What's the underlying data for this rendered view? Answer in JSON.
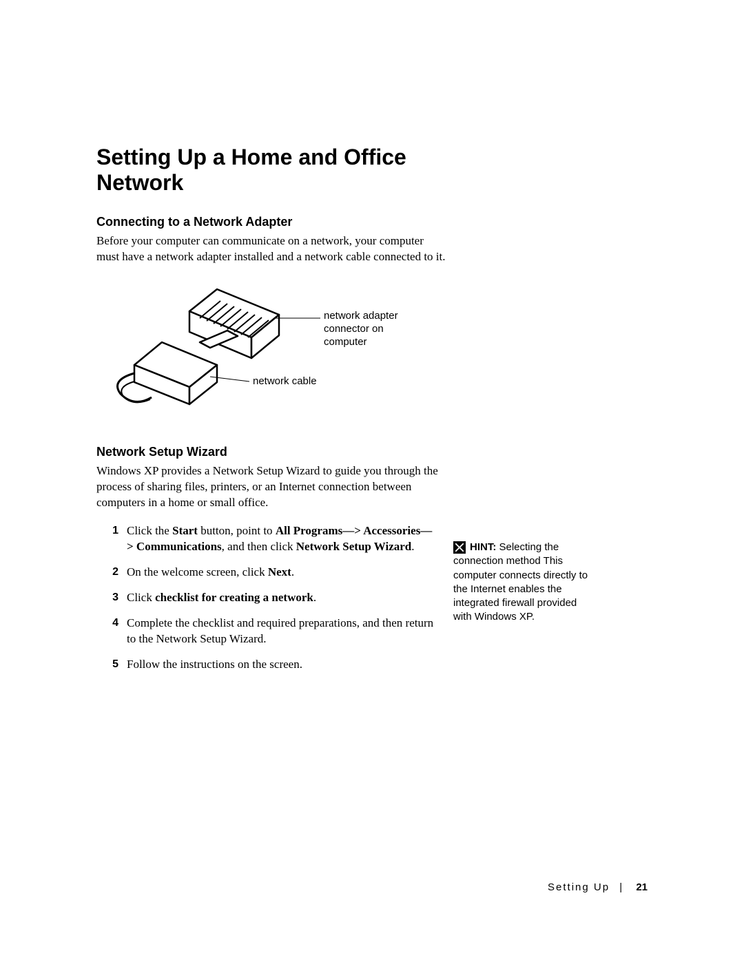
{
  "title": "Setting Up a Home and Office Network",
  "s1": {
    "heading": "Connecting to a Network Adapter",
    "p1": "Before your computer can communicate on a network, your computer must have a network adapter installed and a network cable connected to it."
  },
  "fig": {
    "label_adapter": "network adapter connector on computer",
    "label_cable": "network cable"
  },
  "s2": {
    "heading": "Network Setup Wizard",
    "p1": "Windows XP provides a Network Setup Wizard to guide you through the process of sharing files, printers, or an Internet connection between computers in a home or small office."
  },
  "steps": {
    "n1": "1",
    "n2": "2",
    "n3": "3",
    "n4": "4",
    "n5": "5",
    "t1a": "Click the ",
    "t1b": "Start",
    "t1c": " button, point to ",
    "t1d": "All Programs—> Accessories—> Communications",
    "t1e": ", and then click ",
    "t1f": "Network Setup Wizard",
    "t1g": ".",
    "t2a": "On the welcome screen, click ",
    "t2b": "Next",
    "t2c": ".",
    "t3a": "Click ",
    "t3b": "checklist for creating a network",
    "t3c": ".",
    "t4": "Complete the checklist and required preparations, and then return to the Network Setup Wizard.",
    "t5": "Follow the instructions on the screen."
  },
  "hint": {
    "label": "HINT:",
    "a": " Selecting the connection method ",
    "b": "This computer connects directly to the Internet",
    "c": " enables the integrated firewall provided with Windows XP."
  },
  "footer": {
    "section": "Setting Up",
    "sep": "|",
    "page": "21"
  }
}
